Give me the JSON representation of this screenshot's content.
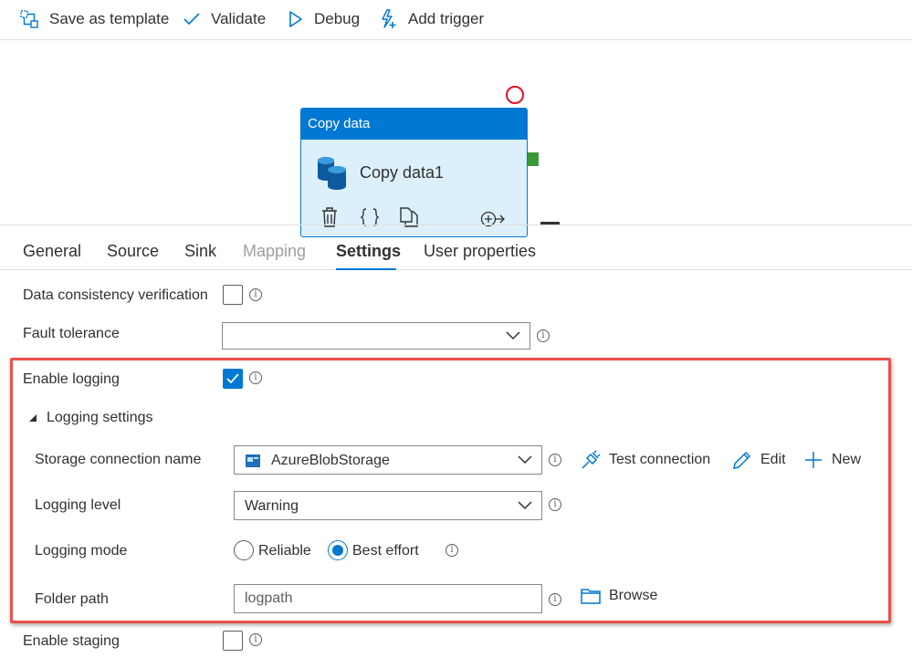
{
  "toolbar": {
    "save_template": "Save as template",
    "validate": "Validate",
    "debug": "Debug",
    "add_trigger": "Add trigger"
  },
  "activity": {
    "type": "Copy data",
    "name": "Copy data1"
  },
  "tabs": [
    {
      "label": "General",
      "state": "normal"
    },
    {
      "label": "Source",
      "state": "normal"
    },
    {
      "label": "Sink",
      "state": "normal"
    },
    {
      "label": "Mapping",
      "state": "disabled"
    },
    {
      "label": "Settings",
      "state": "active"
    },
    {
      "label": "User properties",
      "state": "normal"
    }
  ],
  "settings": {
    "data_consistency": {
      "label": "Data consistency verification",
      "checked": false
    },
    "fault_tolerance": {
      "label": "Fault tolerance",
      "value": ""
    },
    "enable_logging": {
      "label": "Enable logging",
      "checked": true
    },
    "logging_settings": {
      "title": "Logging settings",
      "storage_connection": {
        "label": "Storage connection name",
        "value": "AzureBlobStorage",
        "test_connection": "Test connection",
        "edit": "Edit",
        "new": "New"
      },
      "logging_level": {
        "label": "Logging level",
        "value": "Warning"
      },
      "logging_mode": {
        "label": "Logging mode",
        "options": [
          "Reliable",
          "Best effort"
        ],
        "selected": "Best effort"
      },
      "folder_path": {
        "label": "Folder path",
        "value": "logpath",
        "browse": "Browse"
      }
    },
    "enable_staging": {
      "label": "Enable staging",
      "checked": false
    }
  },
  "colors": {
    "accent": "#0078d4",
    "highlight_border": "#e8524a",
    "error": "#e81123",
    "success_port": "#3a9a3a"
  },
  "info_glyph": "i"
}
